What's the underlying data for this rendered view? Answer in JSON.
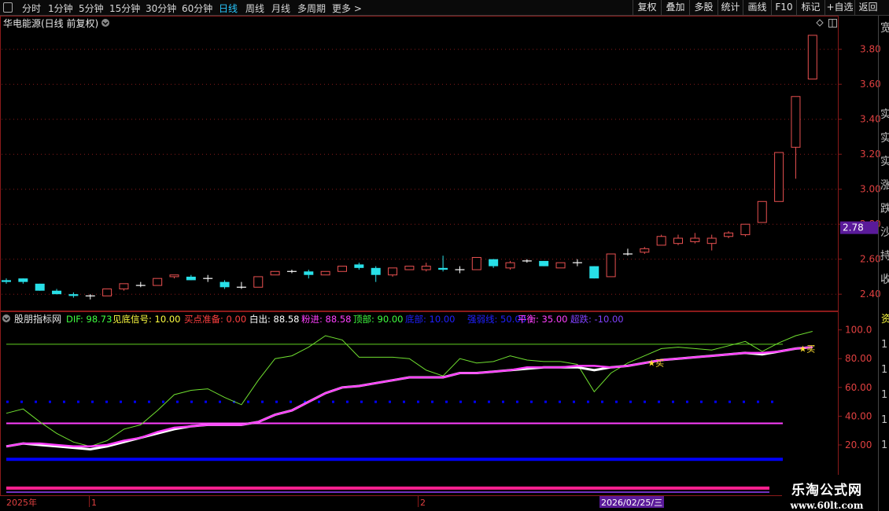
{
  "topbar": {
    "periods": [
      "分时",
      "1分钟",
      "5分钟",
      "15分钟",
      "30分钟",
      "60分钟",
      "日线",
      "周线",
      "月线",
      "多周期",
      "更多 >"
    ],
    "active_period": "日线",
    "tools": [
      "复权",
      "叠加",
      "多股",
      "统计",
      "画线",
      "F10",
      "标记",
      "+自选",
      "返回"
    ]
  },
  "stock": {
    "title": "华电能源(日线 前复权)",
    "current_price_tag": "2.78"
  },
  "colors": {
    "up": "#e85050",
    "down": "#28e0e8",
    "doji": "#ffffff",
    "dif": "#80ff40",
    "pink": "#ff40ff",
    "blue": "#0000ff",
    "grid": "#8b1a1a"
  },
  "price_axis": {
    "ticks": [
      "3.80",
      "3.60",
      "3.40",
      "3.20",
      "3.00",
      "2.80",
      "2.60",
      "2.40"
    ]
  },
  "indicator": {
    "name": "股朋指标网",
    "legend": [
      {
        "text": "DIF: 98.73",
        "color": "#40ff40"
      },
      {
        "text": "见底信号: 10.00",
        "color": "#ffff40"
      },
      {
        "text": "买点准备: 0.00",
        "color": "#ff4040"
      },
      {
        "text": "白出: 88.58",
        "color": "#ffffff"
      },
      {
        "text": "粉进: 88.58",
        "color": "#ff40ff"
      },
      {
        "text": "顶部: 90.00",
        "color": "#40ff40"
      },
      {
        "text": "底部: 10.00",
        "color": "#2020ff"
      },
      {
        "text": "强弱线: 50.00",
        "color": "#2020ff"
      },
      {
        "text": "平衡: 35.00",
        "color": "#ff40ff"
      },
      {
        "text": "超跌: -10.00",
        "color": "#8040ff"
      }
    ],
    "ticks": [
      "100.0",
      "80.00",
      "60.00",
      "40.00",
      "20.00"
    ],
    "buy_labels": [
      "★买",
      "★买"
    ]
  },
  "right_strip": [
    "实",
    "实",
    "实",
    "涨",
    "跌",
    "沙",
    "持",
    "收"
  ],
  "right_strip_top": [
    "宽"
  ],
  "indicator_right": [
    "资",
    "1",
    "1",
    "1",
    "1",
    "1"
  ],
  "timeline": {
    "labels": [
      "2025年",
      "1",
      "2"
    ],
    "cursor_date": "2026/02/25/三"
  },
  "watermark": {
    "line1": "乐淘公式网",
    "line2": "www.60lt.com"
  },
  "chart_data": {
    "type": "candlestick",
    "ylim": [
      2.32,
      3.92
    ],
    "candles": [
      {
        "o": 2.48,
        "c": 2.47,
        "h": 2.49,
        "l": 2.46
      },
      {
        "o": 2.49,
        "c": 2.47,
        "h": 2.49,
        "l": 2.46
      },
      {
        "o": 2.46,
        "c": 2.42,
        "h": 2.46,
        "l": 2.42
      },
      {
        "o": 2.42,
        "c": 2.4,
        "h": 2.43,
        "l": 2.4
      },
      {
        "o": 2.4,
        "c": 2.39,
        "h": 2.41,
        "l": 2.38
      },
      {
        "o": 2.39,
        "c": 2.39,
        "h": 2.4,
        "l": 2.37
      },
      {
        "o": 2.39,
        "c": 2.43,
        "h": 2.43,
        "l": 2.39
      },
      {
        "o": 2.43,
        "c": 2.46,
        "h": 2.46,
        "l": 2.42
      },
      {
        "o": 2.45,
        "c": 2.45,
        "h": 2.47,
        "l": 2.44
      },
      {
        "o": 2.45,
        "c": 2.49,
        "h": 2.49,
        "l": 2.45
      },
      {
        "o": 2.5,
        "c": 2.51,
        "h": 2.51,
        "l": 2.49
      },
      {
        "o": 2.5,
        "c": 2.48,
        "h": 2.51,
        "l": 2.48
      },
      {
        "o": 2.49,
        "c": 2.49,
        "h": 2.51,
        "l": 2.47
      },
      {
        "o": 2.47,
        "c": 2.44,
        "h": 2.48,
        "l": 2.43
      },
      {
        "o": 2.44,
        "c": 2.44,
        "h": 2.47,
        "l": 2.43
      },
      {
        "o": 2.44,
        "c": 2.5,
        "h": 2.5,
        "l": 2.44
      },
      {
        "o": 2.51,
        "c": 2.53,
        "h": 2.53,
        "l": 2.51
      },
      {
        "o": 2.53,
        "c": 2.53,
        "h": 2.54,
        "l": 2.52
      },
      {
        "o": 2.53,
        "c": 2.51,
        "h": 2.54,
        "l": 2.49
      },
      {
        "o": 2.51,
        "c": 2.53,
        "h": 2.53,
        "l": 2.51
      },
      {
        "o": 2.53,
        "c": 2.56,
        "h": 2.56,
        "l": 2.53
      },
      {
        "o": 2.57,
        "c": 2.55,
        "h": 2.58,
        "l": 2.54
      },
      {
        "o": 2.55,
        "c": 2.51,
        "h": 2.56,
        "l": 2.47
      },
      {
        "o": 2.51,
        "c": 2.55,
        "h": 2.55,
        "l": 2.5
      },
      {
        "o": 2.54,
        "c": 2.56,
        "h": 2.56,
        "l": 2.54
      },
      {
        "o": 2.54,
        "c": 2.56,
        "h": 2.58,
        "l": 2.53
      },
      {
        "o": 2.55,
        "c": 2.54,
        "h": 2.62,
        "l": 2.53
      },
      {
        "o": 2.54,
        "c": 2.54,
        "h": 2.56,
        "l": 2.52
      },
      {
        "o": 2.54,
        "c": 2.61,
        "h": 2.61,
        "l": 2.54
      },
      {
        "o": 2.6,
        "c": 2.56,
        "h": 2.6,
        "l": 2.55
      },
      {
        "o": 2.55,
        "c": 2.58,
        "h": 2.59,
        "l": 2.54
      },
      {
        "o": 2.59,
        "c": 2.59,
        "h": 2.6,
        "l": 2.58
      },
      {
        "o": 2.59,
        "c": 2.56,
        "h": 2.59,
        "l": 2.56
      },
      {
        "o": 2.55,
        "c": 2.58,
        "h": 2.58,
        "l": 2.55
      },
      {
        "o": 2.58,
        "c": 2.58,
        "h": 2.6,
        "l": 2.56
      },
      {
        "o": 2.56,
        "c": 2.49,
        "h": 2.56,
        "l": 2.49
      },
      {
        "o": 2.5,
        "c": 2.63,
        "h": 2.63,
        "l": 2.5
      },
      {
        "o": 2.63,
        "c": 2.63,
        "h": 2.66,
        "l": 2.62
      },
      {
        "o": 2.64,
        "c": 2.66,
        "h": 2.67,
        "l": 2.63
      },
      {
        "o": 2.68,
        "c": 2.73,
        "h": 2.74,
        "l": 2.68
      },
      {
        "o": 2.69,
        "c": 2.72,
        "h": 2.74,
        "l": 2.68
      },
      {
        "o": 2.7,
        "c": 2.72,
        "h": 2.75,
        "l": 2.69
      },
      {
        "o": 2.69,
        "c": 2.72,
        "h": 2.74,
        "l": 2.65
      },
      {
        "o": 2.73,
        "c": 2.75,
        "h": 2.76,
        "l": 2.72
      },
      {
        "o": 2.74,
        "c": 2.8,
        "h": 2.8,
        "l": 2.73
      },
      {
        "o": 2.81,
        "c": 2.93,
        "h": 2.93,
        "l": 2.81
      },
      {
        "o": 2.93,
        "c": 3.21,
        "h": 3.21,
        "l": 2.93
      },
      {
        "o": 3.24,
        "c": 3.53,
        "h": 3.53,
        "l": 3.06
      },
      {
        "o": 3.63,
        "c": 3.88,
        "h": 3.88,
        "l": 3.63
      }
    ],
    "dif": [
      42,
      45,
      36,
      28,
      22,
      19,
      23,
      31,
      34,
      44,
      55,
      58,
      59,
      53,
      48,
      65,
      80,
      82,
      88,
      96,
      93,
      81,
      81,
      81,
      80,
      72,
      68,
      80,
      77,
      78,
      82,
      79,
      78,
      78,
      76,
      57,
      70,
      77,
      82,
      87,
      88,
      87,
      86,
      89,
      92,
      85,
      91,
      96,
      99
    ],
    "white_line": [
      19,
      21,
      20,
      19,
      18,
      17,
      19,
      22,
      25,
      28,
      31,
      33,
      34,
      34,
      34,
      36,
      41,
      44,
      50,
      56,
      60,
      61,
      63,
      65,
      67,
      67,
      67,
      70,
      70,
      71,
      72,
      73,
      74,
      74,
      74,
      72,
      74,
      75,
      77,
      79,
      80,
      81,
      82,
      83,
      84,
      83,
      85,
      87,
      88
    ],
    "pink_line": [
      19,
      21,
      21,
      20,
      19,
      19,
      20,
      23,
      25,
      29,
      32,
      33,
      34,
      34,
      34,
      36,
      41,
      44,
      50,
      56,
      60,
      61,
      63,
      65,
      67,
      67,
      67,
      70,
      70,
      71,
      72,
      74,
      74,
      74,
      75,
      75,
      74,
      75,
      77,
      79,
      80,
      81,
      82,
      83,
      84,
      84,
      85,
      87,
      88
    ],
    "levels": {
      "top": 90,
      "strength": 50,
      "balance": 35,
      "bottom": 10,
      "oversold": -10
    },
    "buy_signals": [
      38,
      47
    ],
    "indicator_ylim": [
      -15,
      108
    ]
  }
}
